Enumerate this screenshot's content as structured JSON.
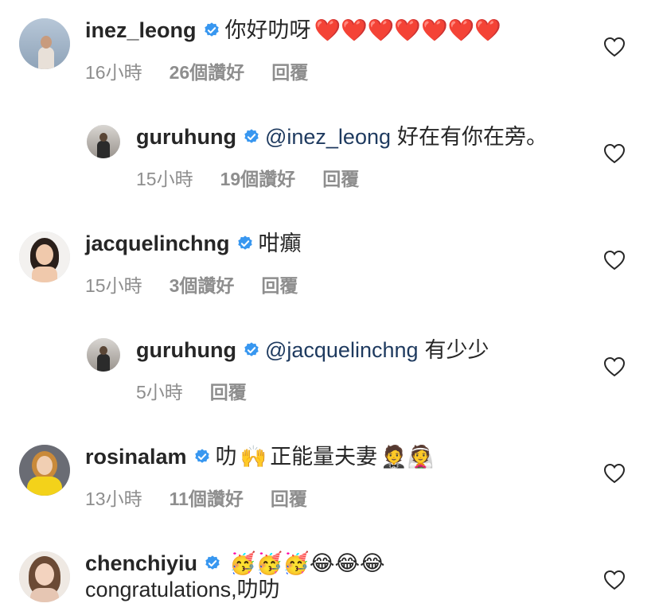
{
  "comments": [
    {
      "username": "inez_leong",
      "text": "你好叻呀",
      "emoji": "❤️❤️❤️❤️❤️❤️❤️",
      "time": "16小時",
      "likes": "26個讚好",
      "reply": "回覆"
    },
    {
      "username": "guruhung",
      "mention": "@inez_leong",
      "text": "好在有你在旁。",
      "time": "15小時",
      "likes": "19個讚好",
      "reply": "回覆"
    },
    {
      "username": "jacquelinchng",
      "text": "咁癲",
      "time": "15小時",
      "likes": "3個讚好",
      "reply": "回覆"
    },
    {
      "username": "guruhung",
      "mention": "@jacquelinchng",
      "text": "有少少",
      "time": "5小時",
      "reply": "回覆"
    },
    {
      "username": "rosinalam",
      "text": "叻",
      "emoji1": "🙌",
      "text2": "正能量夫妻",
      "emoji2": "🤵👰",
      "time": "13小時",
      "likes": "11個讚好",
      "reply": "回覆"
    },
    {
      "username": "chenchiyiu",
      "emoji": "🥳🥳🥳😂😂😂",
      "text_line2": "congratulations,叻叻"
    }
  ],
  "colors": {
    "verified": "#3897f0",
    "mention": "#1e3a5f",
    "meta": "#8e8e8e",
    "text": "#262626"
  }
}
